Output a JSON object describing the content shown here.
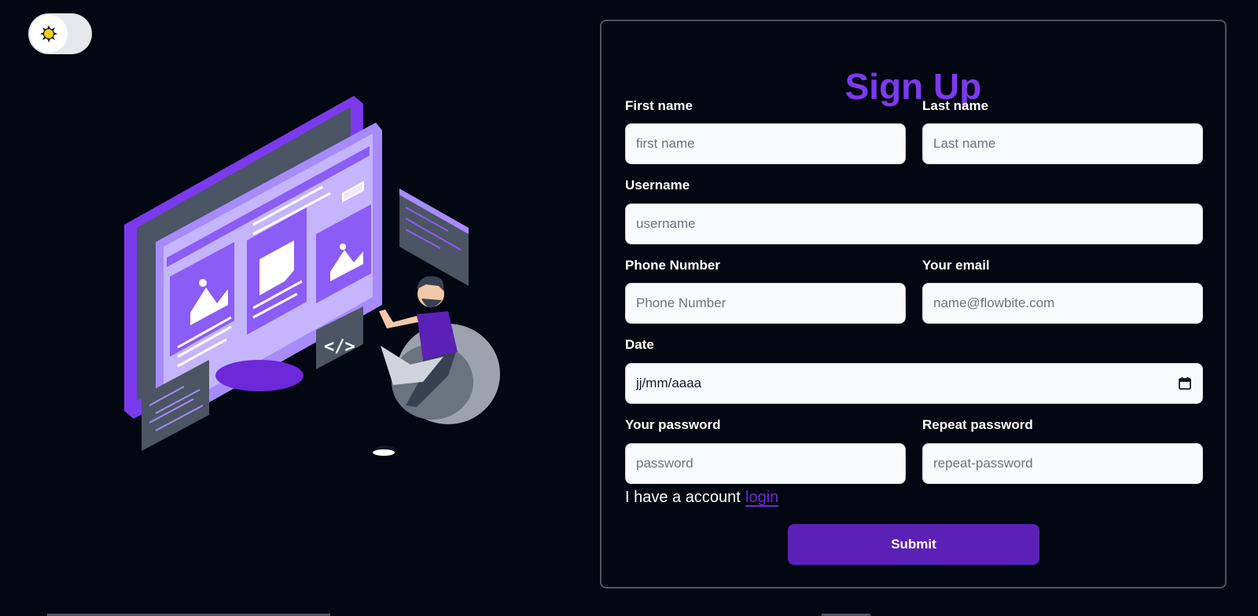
{
  "theme_toggle": {
    "icon": "sun-icon",
    "state": "light-knob"
  },
  "form": {
    "title": "Sign Up",
    "first_name": {
      "label": "First name",
      "placeholder": "first name"
    },
    "last_name": {
      "label": "Last name",
      "placeholder": "Last name"
    },
    "username": {
      "label": "Username",
      "placeholder": "username"
    },
    "phone": {
      "label": "Phone Number",
      "placeholder": "Phone Number"
    },
    "email": {
      "label": "Your email",
      "placeholder": "name@flowbite.com"
    },
    "date": {
      "label": "Date",
      "value": "jj/mm/aaaa",
      "icon": "calendar-icon"
    },
    "password": {
      "label": "Your password",
      "placeholder": "password"
    },
    "repeat_password": {
      "label": "Repeat password",
      "placeholder": "repeat-password"
    },
    "account_text": "I have a account",
    "login_link": "login",
    "submit_label": "Submit"
  },
  "colors": {
    "background": "#030712",
    "accent": "#7c3aed",
    "button": "#5b21b6",
    "card_border": "#4b5563",
    "input_bg": "#f9fafb"
  },
  "illustration": {
    "code_symbol": "</>"
  }
}
